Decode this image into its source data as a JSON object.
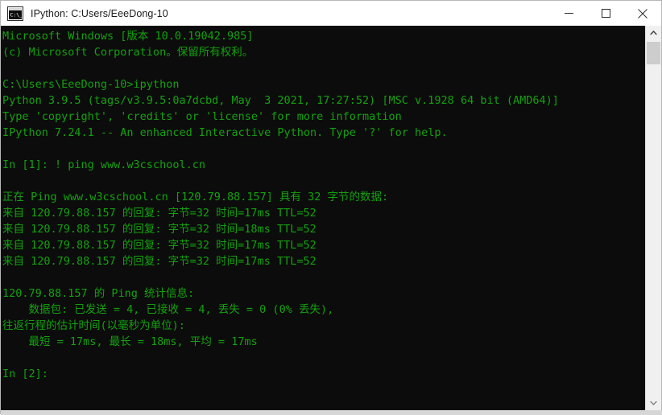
{
  "window": {
    "title": "IPython: C:Users/EeeDong-10",
    "icon": "console-icon",
    "controls": {
      "minimize": "minimize-icon",
      "maximize": "maximize-icon",
      "close": "close-icon"
    }
  },
  "colors": {
    "terminal_background": "#0c0c0c",
    "terminal_foreground": "#13a10e",
    "titlebar_background": "#ffffff",
    "titlebar_foreground": "#1b1b1b",
    "scrollbar_track": "#f0f0f0",
    "scrollbar_thumb": "#cdcdcd"
  },
  "scrollbar": {
    "up_arrow": "chevron-up-icon",
    "down_arrow": "chevron-down-icon"
  },
  "terminal": {
    "lines": [
      "Microsoft Windows [版本 10.0.19042.985]",
      "(c) Microsoft Corporation。保留所有权利。",
      "",
      "C:\\Users\\EeeDong-10>ipython",
      "Python 3.9.5 (tags/v3.9.5:0a7dcbd, May  3 2021, 17:27:52) [MSC v.1928 64 bit (AMD64)]",
      "Type 'copyright', 'credits' or 'license' for more information",
      "IPython 7.24.1 -- An enhanced Interactive Python. Type '?' for help.",
      "",
      "In [1]: ! ping www.w3cschool.cn",
      "",
      "正在 Ping www.w3cschool.cn [120.79.88.157] 具有 32 字节的数据:",
      "来自 120.79.88.157 的回复: 字节=32 时间=17ms TTL=52",
      "来自 120.79.88.157 的回复: 字节=32 时间=18ms TTL=52",
      "来自 120.79.88.157 的回复: 字节=32 时间=17ms TTL=52",
      "来自 120.79.88.157 的回复: 字节=32 时间=17ms TTL=52",
      "",
      "120.79.88.157 的 Ping 统计信息:",
      "    数据包: 已发送 = 4, 已接收 = 4, 丢失 = 0 (0% 丢失),",
      "往返行程的估计时间(以毫秒为单位):",
      "    最短 = 17ms, 最长 = 18ms, 平均 = 17ms",
      "",
      "In [2]:"
    ]
  }
}
